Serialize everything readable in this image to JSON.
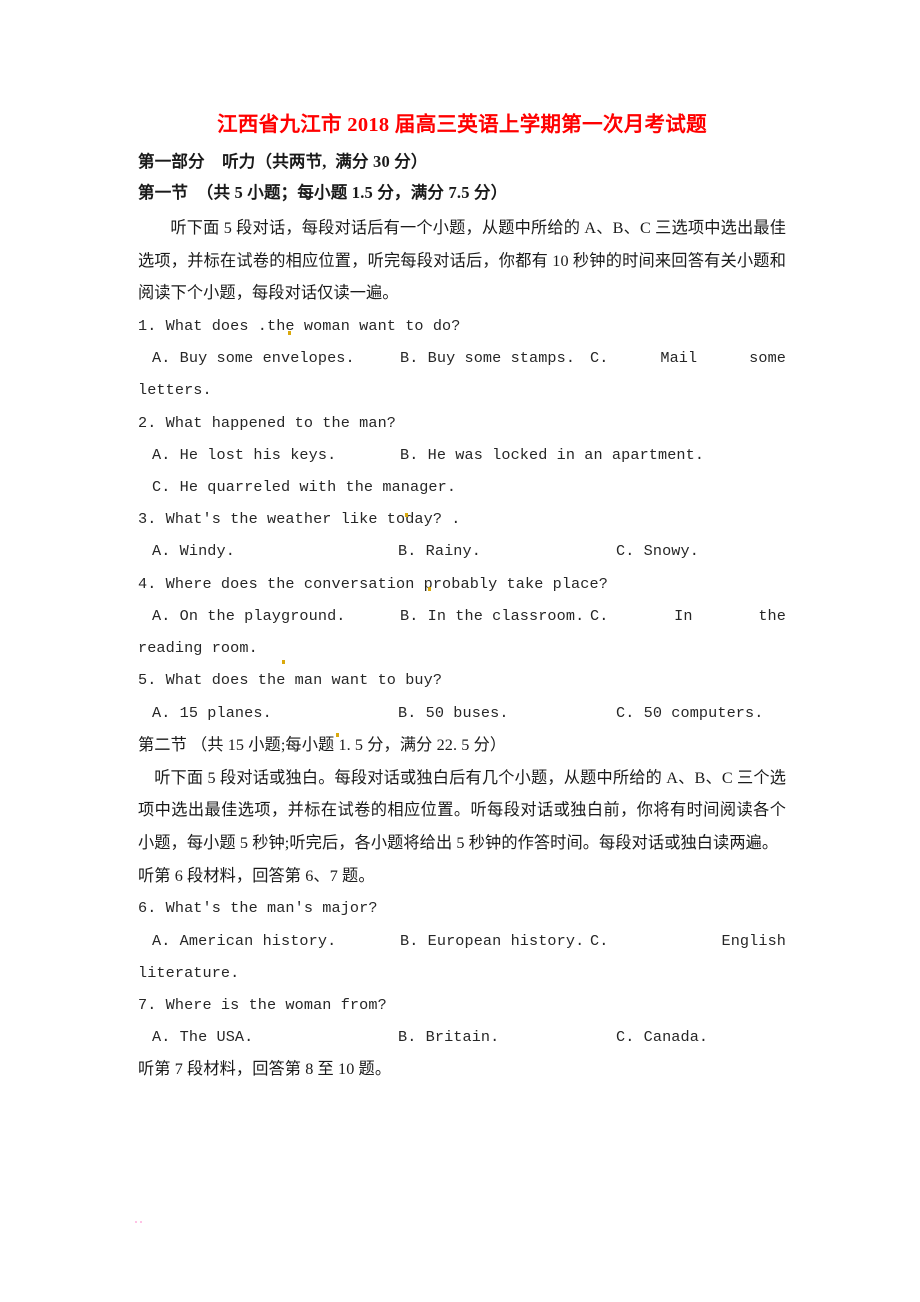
{
  "document": {
    "title": "江西省九江市 2018 届高三英语上学期第一次月考试题",
    "title_color": "#ff0000"
  },
  "part_one": {
    "heading": "第一部分    听力（共两节,  满分 30 分）",
    "section_one_heading": "第一节  （共 5 小题；每小题 1.5 分，满分 7.5 分）",
    "section_one_directions": "听下面 5 段对话，每段对话后有一个小题，从题中所给的 A、B、C 三选项中选出最佳选项，并标在试卷的相应位置，听完每段对话后，你都有 10 秒钟的时间来回答有关小题和阅读下个小题，每段对话仅读一遍。",
    "section_two_heading": "第二节 （共 15 小题;每小题 1. 5 分，满分 22. 5 分）",
    "section_two_directions": "听下面 5 段对话或独白。每段对话或独白后有几个小题，从题中所给的 A、B、C 三个选项中选出最佳选项，并标在试卷的相应位置。听每段对话或独白前，你将有时间阅读各个小题，每小题 5 秒钟;听完后，各小题将给出 5 秒钟的作答时间。每段对话或独白读两遍。"
  },
  "material_cues": {
    "cue_6": "听第 6 段材料，回答第 6、7 题。",
    "cue_7": "听第 7 段材料，回答第 8 至 10 题。"
  },
  "questions": [
    {
      "number": "1.",
      "stem": "1. What does .the woman want to do?",
      "options": [
        "A. Buy some envelopes.",
        "B. Buy some stamps.",
        "C.",
        "Mail",
        "some"
      ],
      "continuation": "letters.",
      "layout": "justified-wrap"
    },
    {
      "number": "2.",
      "stem": "2. What happened to the man?",
      "options_row1": [
        "A. He lost his keys.",
        "B. He was locked in an apartment."
      ],
      "options_row2": [
        "C. He quarreled with the manager."
      ],
      "layout": "two-line"
    },
    {
      "number": "3.",
      "stem": "3. What's the weather like today? .",
      "options": [
        "A. Windy.",
        "B. Rainy.",
        "C. Snowy."
      ],
      "layout": "three-col"
    },
    {
      "number": "4.",
      "stem": "4. Where does the conversation probably take place?",
      "options": [
        "A. On the playground.",
        "B. In the classroom.",
        "C.",
        "In",
        "the"
      ],
      "continuation": "reading room.",
      "layout": "justified-wrap"
    },
    {
      "number": "5.",
      "stem": "5. What does the man want to buy?",
      "options": [
        "A. 15 planes.",
        "B. 50 buses.",
        "C. 50 computers."
      ],
      "layout": "three-col"
    },
    {
      "number": "6.",
      "stem": "6. What's the man's major?",
      "options": [
        "A. American history.",
        "B. European history.",
        "C.",
        "",
        "English"
      ],
      "continuation": "literature.",
      "layout": "justified-wrap"
    },
    {
      "number": "7.",
      "stem": "7. Where is the woman from?",
      "options": [
        "A. The USA.",
        "B. Britain.",
        "C. Canada."
      ],
      "layout": "three-col"
    }
  ]
}
